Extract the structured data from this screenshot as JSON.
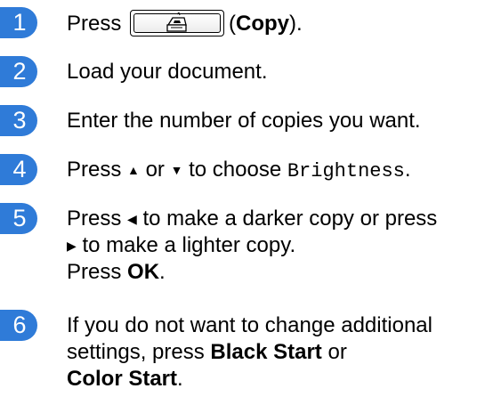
{
  "step_color": "#2f7bd8",
  "steps": [
    {
      "number": "1",
      "press": "Press",
      "copy_label": "Copy",
      "open_paren": "(",
      "close_paren": ")."
    },
    {
      "number": "2",
      "text": "Load your document."
    },
    {
      "number": "3",
      "text": "Enter the number of copies you want."
    },
    {
      "number": "4",
      "press": "Press",
      "up_arrow": "▲",
      "or": "or",
      "down_arrow": "▼",
      "to_choose": "to choose",
      "option": "Brightness",
      "period": "."
    },
    {
      "number": "5",
      "press": "Press",
      "left_arrow": "◀",
      "line1_rest": "to make a darker copy or press",
      "right_arrow": "▶",
      "line2_rest": "to make a lighter copy.",
      "press2": "Press",
      "ok": "OK",
      "period": "."
    },
    {
      "number": "6",
      "line1": "If you do not want to change additional",
      "line2a": "settings, press",
      "black_start": "Black Start",
      "or": "or",
      "color_start": "Color Start",
      "period": "."
    }
  ],
  "icons": {
    "copy_key": "copy-machine-icon"
  }
}
